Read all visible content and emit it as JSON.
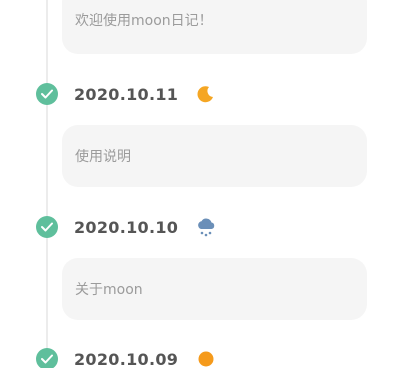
{
  "entries": [
    {
      "card_text": "欢迎使用moon日记！"
    },
    {
      "date": "2020.10.11",
      "weather_icon": "moon-icon",
      "card_text": "使用说明"
    },
    {
      "date": "2020.10.10",
      "weather_icon": "snow-cloud-icon",
      "card_text": "关于moon"
    },
    {
      "date": "2020.10.09",
      "weather_icon": "sun-icon"
    }
  ],
  "colors": {
    "check": "#5fbf9c",
    "card_bg": "#f5f5f5",
    "moon": "#f5a623",
    "cloud": "#6b8fb8",
    "sun": "#f59a1b"
  }
}
